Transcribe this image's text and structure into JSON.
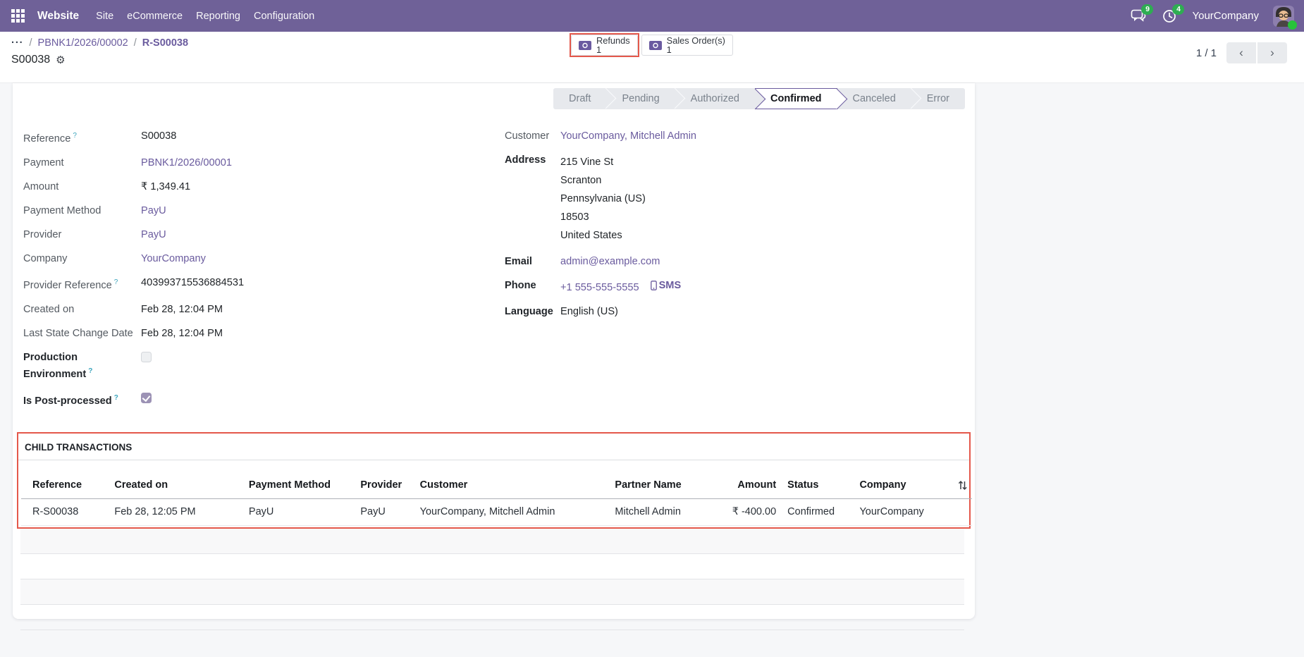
{
  "navbar": {
    "app_name": "Website",
    "menus": [
      "Site",
      "eCommerce",
      "Reporting",
      "Configuration"
    ],
    "badges": {
      "messages": "9",
      "activities": "4"
    },
    "company": "YourCompany"
  },
  "breadcrumb": {
    "ellipsis": "···",
    "items": [
      "PBNK1/2026/00002",
      "R-S00038"
    ],
    "title": "S00038"
  },
  "stat_buttons": [
    {
      "label": "Refunds",
      "value": "1",
      "annotated": true
    },
    {
      "label": "Sales Order(s)",
      "value": "1",
      "annotated": false
    }
  ],
  "pager": {
    "text": "1 / 1"
  },
  "statusbar": {
    "steps": [
      "Draft",
      "Pending",
      "Authorized",
      "Confirmed",
      "Canceled",
      "Error"
    ],
    "active": "Confirmed"
  },
  "fields_left": [
    {
      "label": "Reference",
      "help": true,
      "type": "text",
      "value": "S00038"
    },
    {
      "label": "Payment",
      "type": "link",
      "value": "PBNK1/2026/00001"
    },
    {
      "label": "Amount",
      "type": "text",
      "value": "₹ 1,349.41"
    },
    {
      "label": "Payment Method",
      "type": "link",
      "value": "PayU"
    },
    {
      "label": "Provider",
      "type": "link",
      "value": "PayU"
    },
    {
      "label": "Company",
      "type": "link",
      "value": "YourCompany"
    },
    {
      "label": "Provider Reference",
      "help": true,
      "type": "text",
      "value": "403993715536884531"
    },
    {
      "label": "Created on",
      "type": "text",
      "value": "Feb 28, 12:04 PM"
    },
    {
      "label": "Last State Change Date",
      "type": "text",
      "value": "Feb 28, 12:04 PM"
    },
    {
      "label": "Production Environment",
      "help": true,
      "bold": true,
      "type": "checkbox",
      "checked": false
    },
    {
      "label": "Is Post-processed",
      "help": true,
      "bold": true,
      "type": "checkbox",
      "checked": true
    }
  ],
  "fields_right": [
    {
      "label": "Customer",
      "type": "link",
      "value": "YourCompany, Mitchell Admin"
    },
    {
      "label": "Address",
      "bold": true,
      "type": "lines",
      "lines": [
        "215 Vine St",
        "Scranton",
        "Pennsylvania (US)",
        "18503",
        "United States"
      ]
    },
    {
      "label": "Email",
      "bold": true,
      "type": "link",
      "value": "admin@example.com"
    },
    {
      "label": "Phone",
      "bold": true,
      "type": "phone",
      "value": "+1 555-555-5555",
      "sms_label": "SMS"
    },
    {
      "label": "Language",
      "bold": true,
      "type": "text",
      "value": "English (US)"
    }
  ],
  "child_transactions": {
    "title": "Child transactions",
    "columns": [
      "Reference",
      "Created on",
      "Payment Method",
      "Provider",
      "Customer",
      "Partner Name",
      "Amount",
      "Status",
      "Company"
    ],
    "rows": [
      [
        "R-S00038",
        "Feb 28, 12:05 PM",
        "PayU",
        "PayU",
        "YourCompany, Mitchell Admin",
        "Mitchell Admin",
        "₹ -400.00",
        "Confirmed",
        "YourCompany"
      ]
    ]
  },
  "colors": {
    "navbar": "#6f6198",
    "link": "#6a5b9e",
    "annotation": "#e4584b",
    "badge_green": "#2ead52",
    "statusbar_bg": "#e7e9ed"
  }
}
